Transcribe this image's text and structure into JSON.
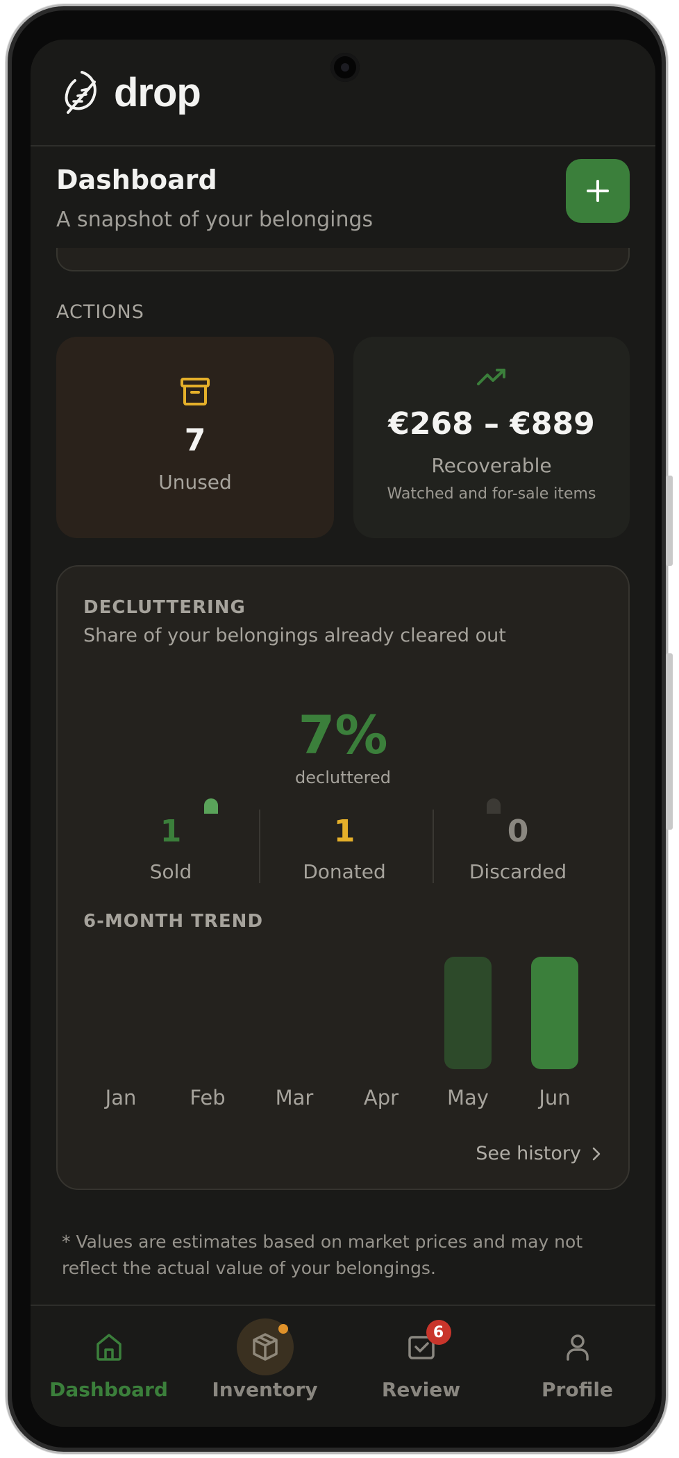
{
  "app": {
    "name": "drop"
  },
  "page": {
    "title": "Dashboard",
    "subtitle": "A snapshot of your belongings"
  },
  "actions": {
    "section_label": "ACTIONS",
    "unused": {
      "value": "7",
      "label": "Unused",
      "icon": "archive-icon",
      "icon_color": "#e5b02a"
    },
    "recoverable": {
      "value": "€268 – €889",
      "label": "Recoverable",
      "note": "Watched and for-sale items",
      "icon": "trending-up-icon",
      "icon_color": "#3b7f3b"
    }
  },
  "decluttering": {
    "title": "DECLUTTERING",
    "subtitle": "Share of your belongings already cleared out",
    "percent_text": "7%",
    "percent_label": "decluttered",
    "stats": [
      {
        "value": "1",
        "label": "Sold",
        "color": "#3b7f3b"
      },
      {
        "value": "1",
        "label": "Donated",
        "color": "#e5b02a"
      },
      {
        "value": "0",
        "label": "Discarded",
        "color": "#8a8780"
      }
    ],
    "trend_title": "6-MONTH TREND",
    "see_history": "See history"
  },
  "chart_data": {
    "type": "bar",
    "categories": [
      "Jan",
      "Feb",
      "Mar",
      "Apr",
      "May",
      "Jun"
    ],
    "values": [
      0,
      0,
      0,
      0,
      1,
      1
    ],
    "bar_colors": [
      "#2d4a2a",
      "#2d4a2a",
      "#2d4a2a",
      "#2d4a2a",
      "#2d4a2a",
      "#3b7f3b"
    ],
    "ylim": [
      0,
      1
    ],
    "grid": false,
    "title": "6-MONTH TREND"
  },
  "disclaimer": "* Values are estimates based on market prices and may not reflect the actual value of your belongings.",
  "nav": {
    "items": [
      {
        "label": "Dashboard",
        "icon": "home-icon",
        "active": true
      },
      {
        "label": "Inventory",
        "icon": "box-icon",
        "dot": true
      },
      {
        "label": "Review",
        "icon": "check-square-icon",
        "badge": "6"
      },
      {
        "label": "Profile",
        "icon": "user-icon"
      }
    ]
  },
  "colors": {
    "accent": "#3b7f3b",
    "warning": "#e5b02a",
    "background": "#1a1a18"
  }
}
